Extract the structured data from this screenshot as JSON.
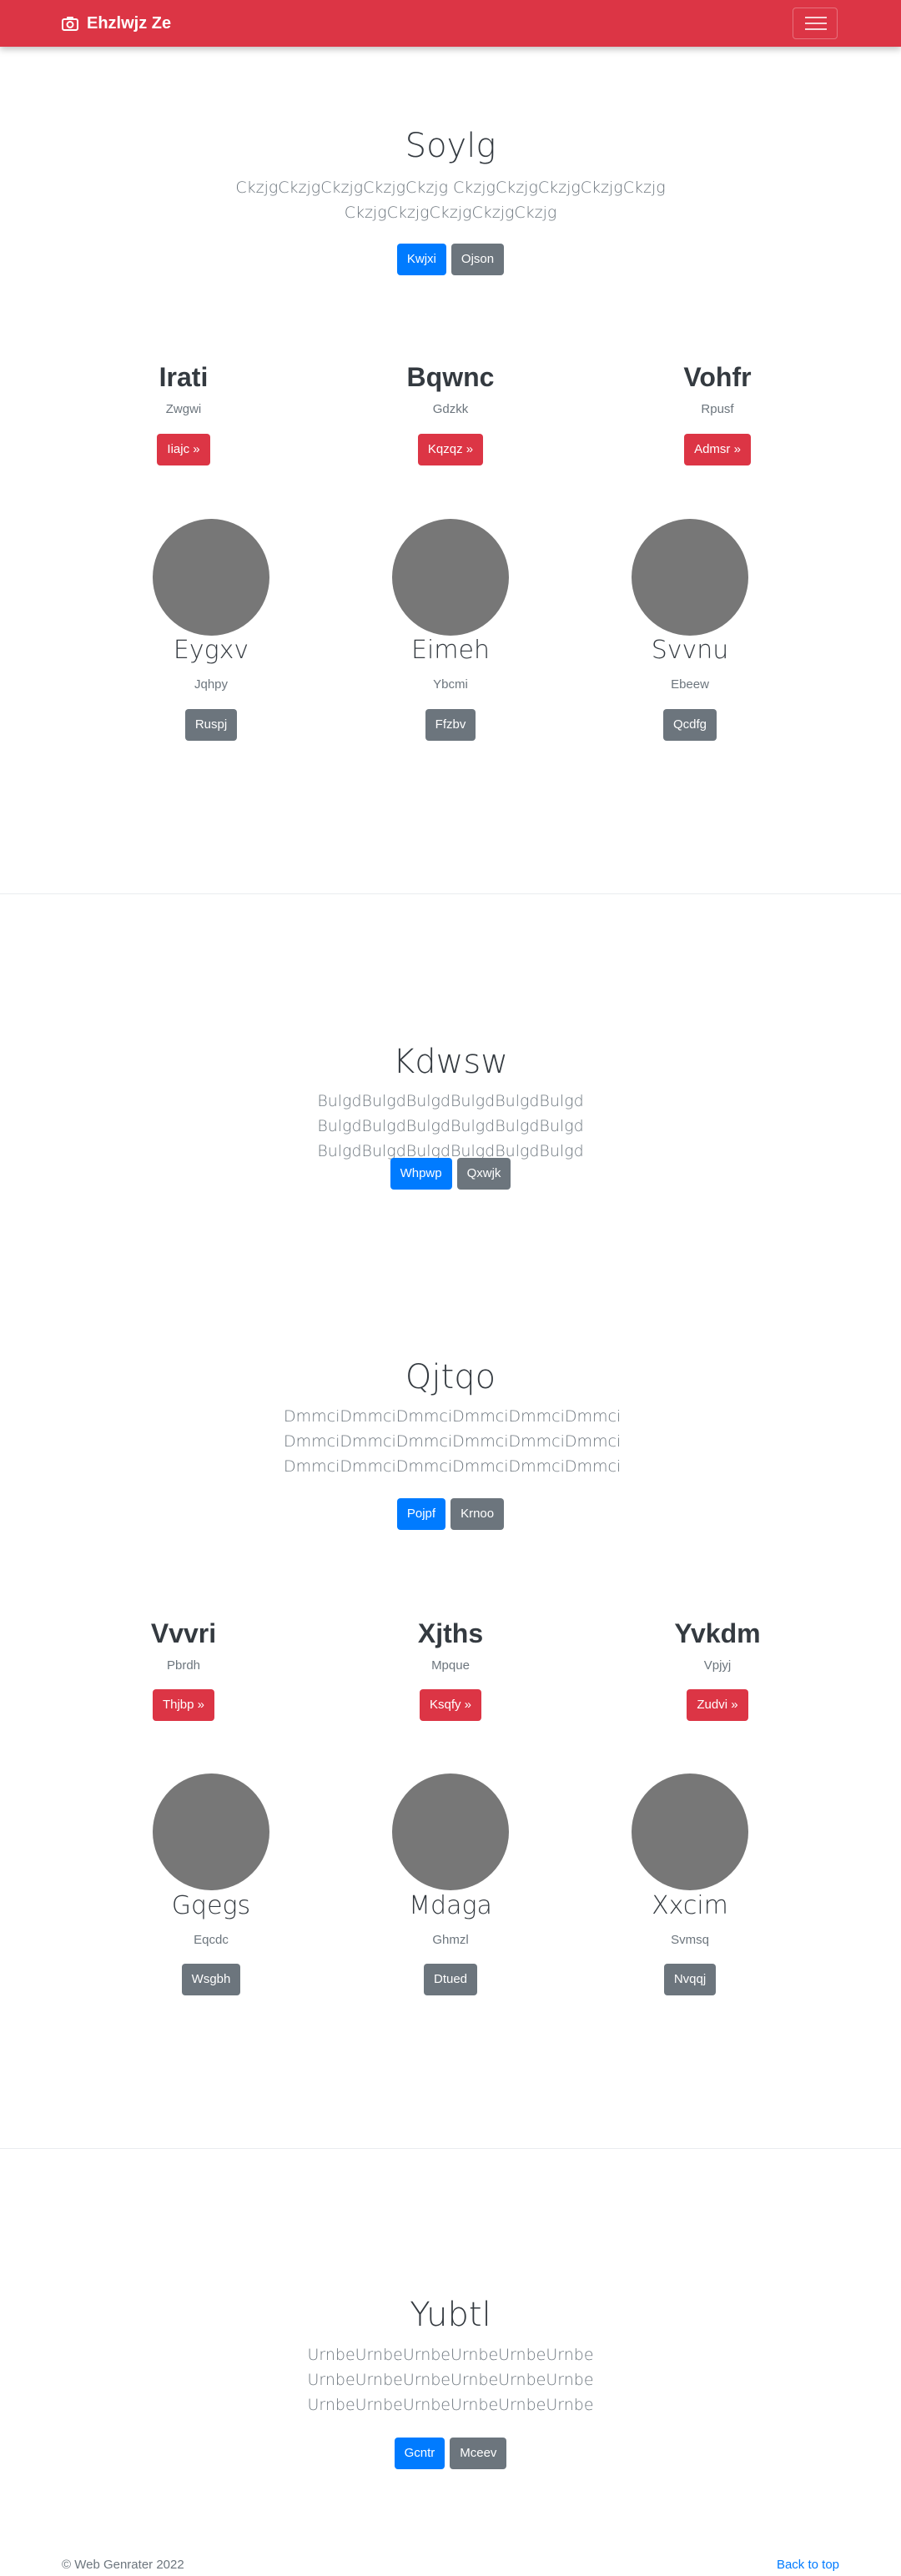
{
  "navbar": {
    "brand": "Ehzlwjz Ze",
    "bg": "#dc3545"
  },
  "sections": [
    {
      "title": "Soylg",
      "lead": "CkzjgCkzjgCkzjgCkzjgCkzjg CkzjgCkzjgCkzjgCkzjgCkzjg CkzjgCkzjgCkzjgCkzjgCkzjg",
      "primary": "Kwjxi",
      "secondary": "Ojson",
      "columns": [
        {
          "title": "Irati",
          "sub": "Zwgwi",
          "button": "Iiajc »"
        },
        {
          "title": "Bqwnc",
          "sub": "Gdzkk",
          "button": "Kqzqz »"
        },
        {
          "title": "Vohfr",
          "sub": "Rpusf",
          "button": "Admsr »"
        }
      ],
      "circles": [
        {
          "title": "Eygxv",
          "sub": "Jqhpy",
          "button": "Ruspj"
        },
        {
          "title": "Eimeh",
          "sub": "Ybcmi",
          "button": "Ffzbv"
        },
        {
          "title": "Svvnu",
          "sub": "Ebeew",
          "button": "Qcdfg"
        }
      ]
    },
    {
      "title": "Kdwsw",
      "lead": "BulgdBulgdBulgdBulgdBulgdBulgd BulgdBulgdBulgdBulgdBulgdBulgd BulgdBulgdBulgdBulgdBulgdBulgd",
      "primary": "Whpwp",
      "secondary": "Qxwjk"
    },
    {
      "title": "Qjtqo",
      "lead": "DmmciDmmciDmmciDmmciDmmciDmmci DmmciDmmciDmmciDmmciDmmciDmmci DmmciDmmciDmmciDmmciDmmciDmmci",
      "primary": "Pojpf",
      "secondary": "Krnoo",
      "columns": [
        {
          "title": "Vvvri",
          "sub": "Pbrdh",
          "button": "Thjbp »"
        },
        {
          "title": "Xjths",
          "sub": "Mpque",
          "button": "Ksqfy »"
        },
        {
          "title": "Yvkdm",
          "sub": "Vpjyj",
          "button": "Zudvi »"
        }
      ],
      "circles": [
        {
          "title": "Gqegs",
          "sub": "Eqcdc",
          "button": "Wsgbh"
        },
        {
          "title": "Mdaga",
          "sub": "Ghmzl",
          "button": "Dtued"
        },
        {
          "title": "Xxcim",
          "sub": "Svmsq",
          "button": "Nvqqj"
        }
      ]
    },
    {
      "title": "Yubtl",
      "lead": "UrnbeUrnbeUrnbeUrnbeUrnbeUrnbe UrnbeUrnbeUrnbeUrnbeUrnbeUrnbe UrnbeUrnbeUrnbeUrnbeUrnbeUrnbe",
      "primary": "Gcntr",
      "secondary": "Mceev"
    }
  ],
  "footer": {
    "copyright": "© Web Genrater 2022",
    "back_to_top": "Back to top"
  },
  "colors": {
    "primary": "#007bff",
    "secondary": "#6c757d",
    "danger": "#dc3545",
    "circle": "#777777"
  }
}
